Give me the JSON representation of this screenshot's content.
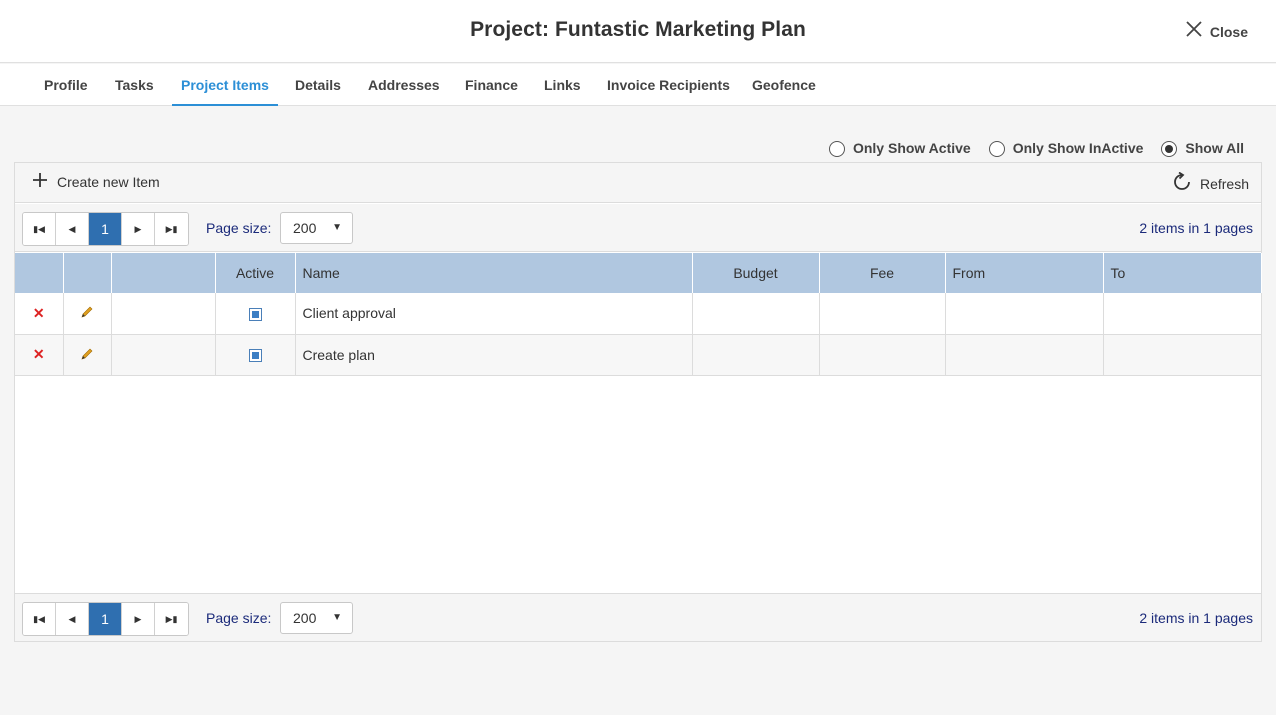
{
  "header": {
    "title": "Project: Funtastic Marketing Plan",
    "close_label": "Close"
  },
  "tabs": [
    {
      "label": "Profile"
    },
    {
      "label": "Tasks"
    },
    {
      "label": "Project Items"
    },
    {
      "label": "Details"
    },
    {
      "label": "Addresses"
    },
    {
      "label": "Finance"
    },
    {
      "label": "Links"
    },
    {
      "label": "Invoice Recipients"
    },
    {
      "label": "Geofence"
    }
  ],
  "active_tab": "Project Items",
  "filters": {
    "options": [
      {
        "label": "Only Show Active",
        "checked": false
      },
      {
        "label": "Only Show InActive",
        "checked": false
      },
      {
        "label": "Show All",
        "checked": true
      }
    ]
  },
  "toolbar": {
    "create_label": "Create new Item",
    "refresh_label": "Refresh"
  },
  "pager": {
    "current_page": "1",
    "page_size_label": "Page size:",
    "page_size": "200",
    "info": "2 items in 1 pages"
  },
  "table": {
    "columns": [
      "",
      "",
      "",
      "Active",
      "Name",
      "Budget",
      "Fee",
      "From",
      "To"
    ],
    "rows": [
      {
        "active": true,
        "name": "Client approval",
        "budget": "",
        "fee": "",
        "from": "",
        "to": ""
      },
      {
        "active": true,
        "name": "Create plan",
        "budget": "",
        "fee": "",
        "from": "",
        "to": ""
      }
    ]
  },
  "colors": {
    "accent": "#2c8fd6",
    "header_row": "#b0c7e0",
    "current_page": "#2f6fb0",
    "pager_text": "#1b2a7a",
    "delete_icon": "#dd2222",
    "edit_icon": "#e0a020"
  }
}
